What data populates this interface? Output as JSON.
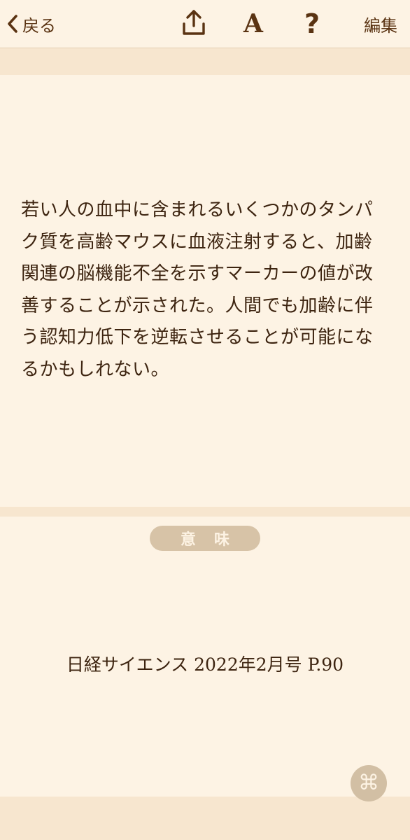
{
  "nav": {
    "back_label": "戻る",
    "edit_label": "編集",
    "font_icon_glyph": "A",
    "help_icon_glyph": "?",
    "icons": [
      "chevron-left-icon",
      "share-icon",
      "font-icon",
      "help-icon"
    ]
  },
  "content": {
    "passage": "若い人の血中に含まれるいくつかのタンパク質を高齢マウスに血液注射すると、加齢関連の脳機能不全を示すマーカーの値が改善することが示された。人間でも加齢に伴う認知力低下を逆転させることが可能になるかもしれない。",
    "meaning_label": "意味",
    "source": "日経サイエンス 2022年2月号 P.90"
  },
  "floating": {
    "command_glyph": "⌘",
    "icon": "command-icon"
  },
  "colors": {
    "background": "#fdf3e4",
    "band": "#f7e6cf",
    "text": "#3d2410",
    "accent": "#5a3312",
    "pill": "#d7c3a7"
  }
}
